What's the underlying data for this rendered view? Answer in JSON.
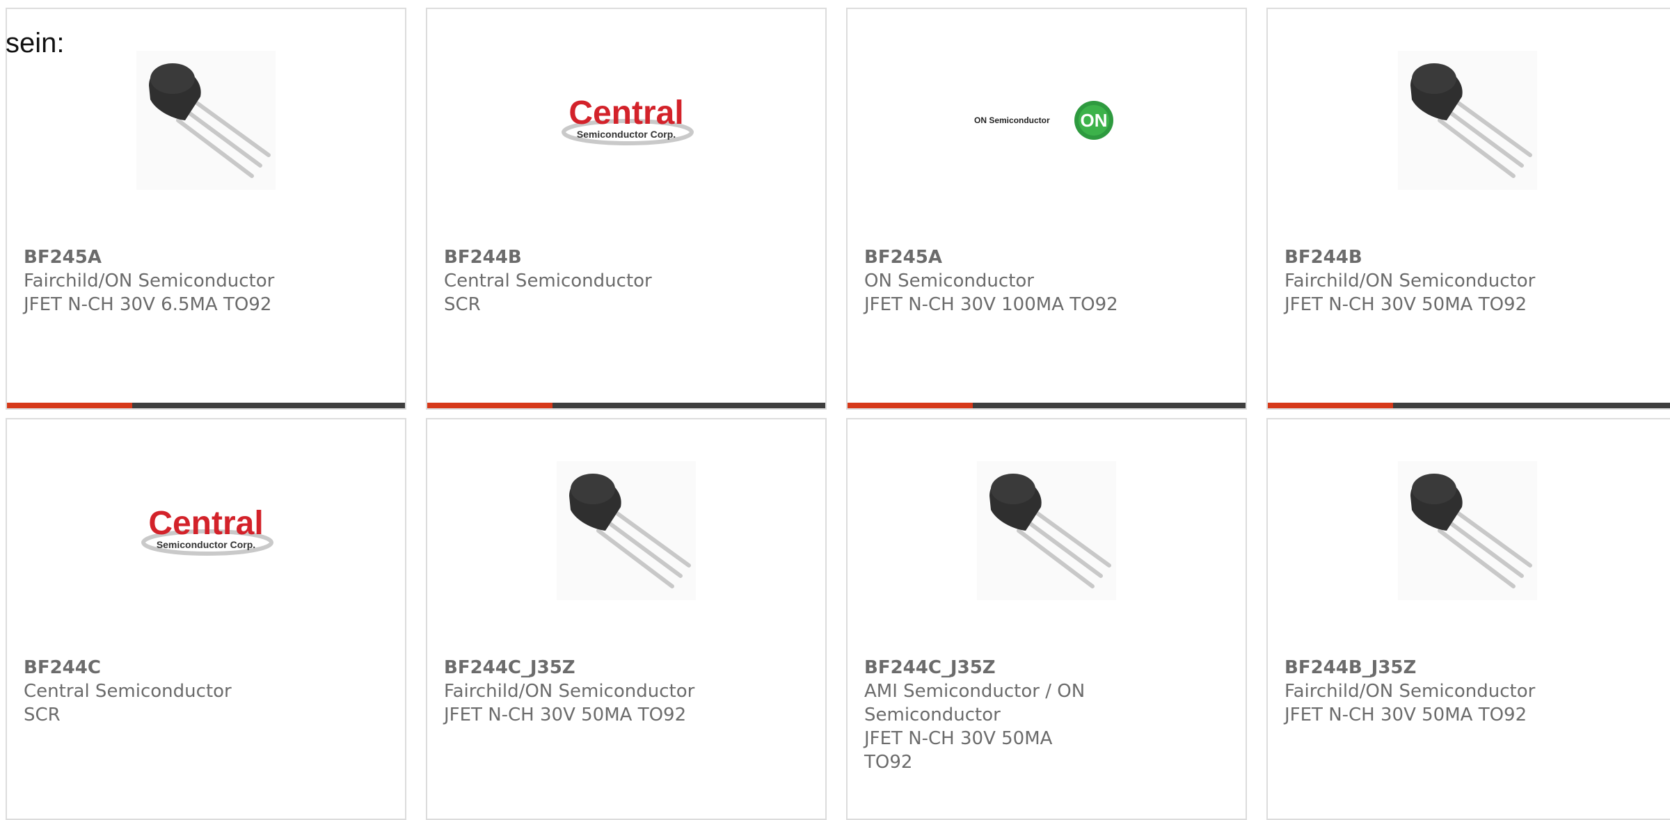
{
  "intro_text": "sein:",
  "colors": {
    "accent": "#d6391a",
    "bar": "#3e3e3e",
    "border": "#dcdcdc",
    "text": "#6b6b6b"
  },
  "products": [
    {
      "part": "BF245A",
      "maker": "Fairchild/ON Semiconductor",
      "desc": "JFET N-CH 30V 6.5MA TO92",
      "image": "to92-transistor-icon"
    },
    {
      "part": "BF244B",
      "maker": "Central Semiconductor",
      "desc": "SCR",
      "image": "central-semiconductor-logo",
      "logo_main": "Central",
      "logo_sub": "Semiconductor Corp."
    },
    {
      "part": "BF245A",
      "maker": "ON Semiconductor",
      "desc": "JFET N-CH 30V 100MA TO92",
      "image": "on-semiconductor-logo",
      "logo_text": "ON Semiconductor",
      "logo_badge": "ON"
    },
    {
      "part": "BF244B",
      "maker": "Fairchild/ON Semiconductor",
      "desc": "JFET N-CH 30V 50MA TO92",
      "image": "to92-transistor-icon"
    },
    {
      "part": "BF244C",
      "maker": "Central Semiconductor",
      "desc": "SCR",
      "image": "central-semiconductor-logo",
      "logo_main": "Central",
      "logo_sub": "Semiconductor Corp."
    },
    {
      "part": "BF244C_J35Z",
      "maker": "Fairchild/ON Semiconductor",
      "desc": "JFET N-CH 30V 50MA TO92",
      "image": "to92-transistor-icon"
    },
    {
      "part": "BF244C_J35Z",
      "maker": "AMI Semiconductor / ON Semiconductor",
      "desc": "JFET N-CH 30V 50MA TO92",
      "image": "to92-transistor-icon"
    },
    {
      "part": "BF244B_J35Z",
      "maker": "Fairchild/ON Semiconductor",
      "desc": "JFET N-CH 30V 50MA TO92",
      "image": "to92-transistor-icon"
    }
  ]
}
